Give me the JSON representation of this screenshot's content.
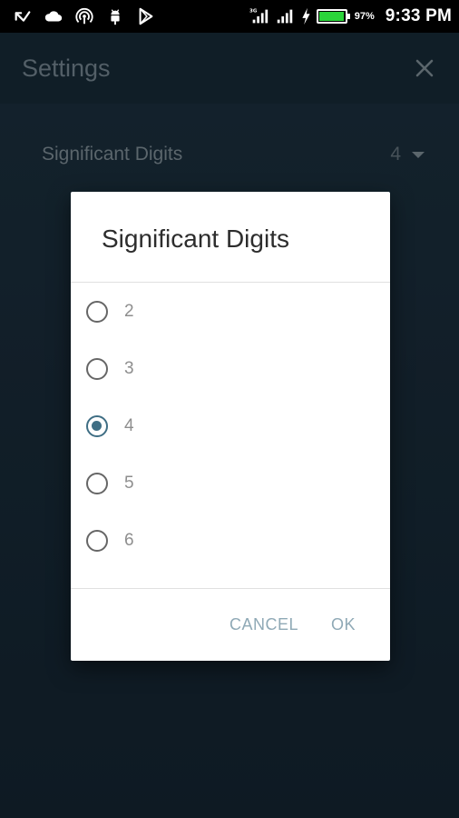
{
  "status_bar": {
    "left_icons": [
      "missed-call-icon",
      "cloud-icon",
      "hotspot-icon",
      "android-debug-icon",
      "play-store-icon"
    ],
    "right_icons": [
      "signal-3g-icon",
      "signal-icon",
      "charging-bolt-icon",
      "battery-icon"
    ],
    "battery_percent_text": "97%",
    "battery_level": 0.97,
    "time": "9:33 PM",
    "network_label": "3G"
  },
  "app": {
    "title": "Settings",
    "close_icon": "close-icon"
  },
  "setting_row": {
    "label": "Significant Digits",
    "value": "4"
  },
  "dialog": {
    "title": "Significant Digits",
    "options": [
      {
        "label": "2",
        "checked": false
      },
      {
        "label": "3",
        "checked": false
      },
      {
        "label": "4",
        "checked": true
      },
      {
        "label": "5",
        "checked": false
      },
      {
        "label": "6",
        "checked": false
      }
    ],
    "cancel_label": "CANCEL",
    "ok_label": "OK"
  },
  "colors": {
    "accent": "#3f6e84",
    "battery_fill": "#2bd43a",
    "app_background": "#1b2e3c"
  }
}
